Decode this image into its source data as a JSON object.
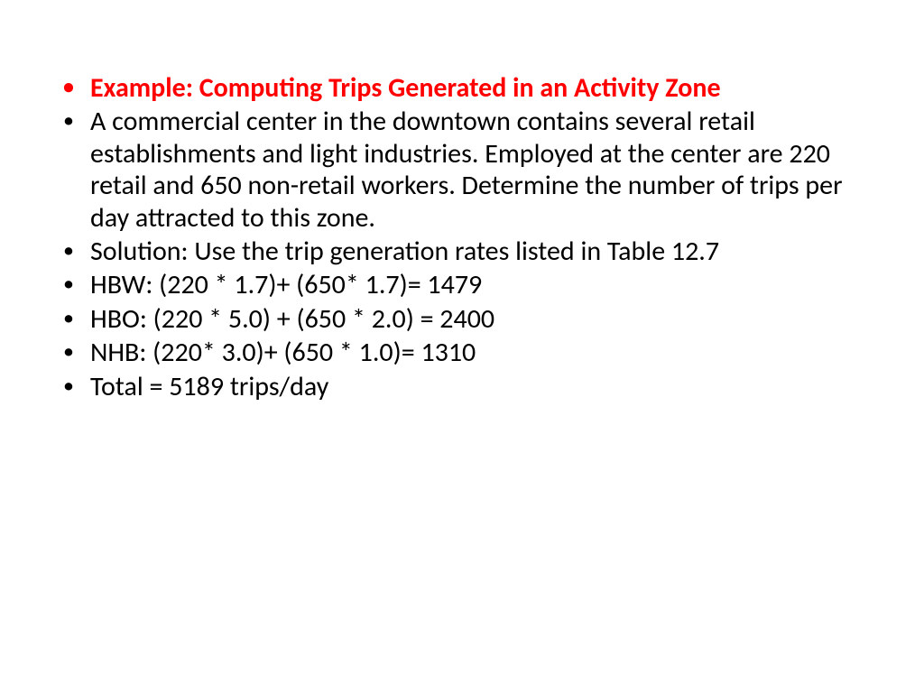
{
  "slide": {
    "items": [
      {
        "text": "Example: Computing Trips Generated in an Activity Zone",
        "title": true
      },
      {
        "text": "A commercial center in the downtown contains several retail establishments and light industries. Employed at the center are 220 retail and 650 non-retail workers. Determine the number of trips per day attracted to this zone.",
        "title": false
      },
      {
        "text": "Solution: Use the trip generation rates listed in Table 12.7",
        "title": false
      },
      {
        "text": "HBW: (220 * 1.7)+ (650* 1.7)= 1479",
        "title": false
      },
      {
        "text": "HBO: (220 * 5.0) + (650 * 2.0) = 2400",
        "title": false
      },
      {
        "text": "NHB: (220* 3.0)+ (650 * 1.0)= 1310",
        "title": false
      },
      {
        "text": "Total = 5189 trips/day",
        "title": false
      }
    ]
  }
}
